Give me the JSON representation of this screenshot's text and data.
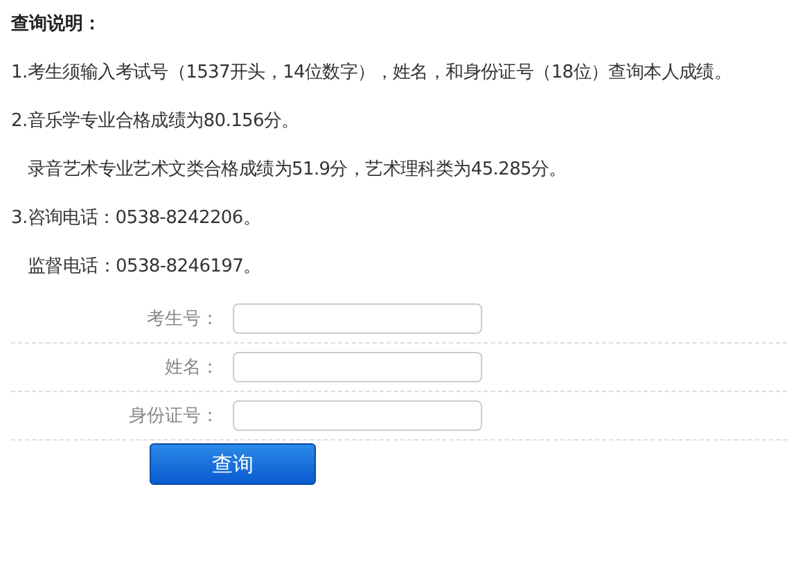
{
  "heading": "查询说明：",
  "notes": [
    {
      "kind": "numbered",
      "text": "1.考生须输入考试号（1537开头，14位数字），姓名，和身份证号（18位）查询本人成绩。"
    },
    {
      "kind": "numbered",
      "text": "2.音乐学专业合格成绩为80.156分。"
    },
    {
      "kind": "continued",
      "text": "录音艺术专业艺术文类合格成绩为51.9分，艺术理科类为45.285分。"
    },
    {
      "kind": "numbered",
      "text": "3.咨询电话：0538-8242206。"
    },
    {
      "kind": "continued",
      "text": "监督电话：0538-8246197。"
    }
  ],
  "form": {
    "fields": [
      {
        "label": "考生号："
      },
      {
        "label": "姓名："
      },
      {
        "label": "身份证号："
      }
    ],
    "submit": "查询"
  }
}
